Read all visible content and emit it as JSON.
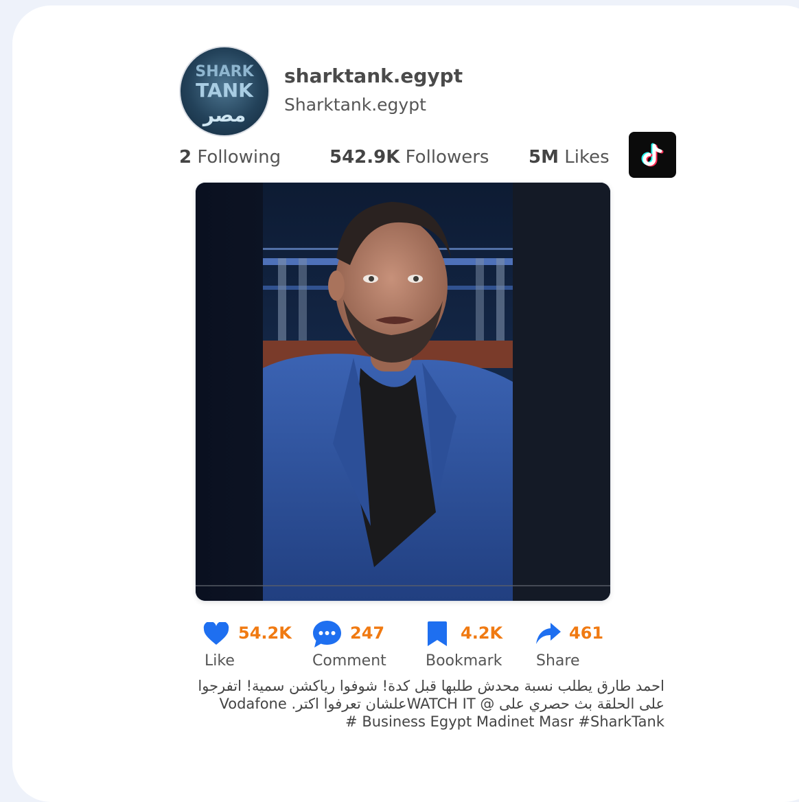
{
  "profile": {
    "username": "sharktank.egypt",
    "handle": "Sharktank.egypt",
    "avatar_text": {
      "line1": "SHARK",
      "line2": "TANK",
      "line3": "مصر"
    }
  },
  "stats": {
    "following": {
      "value": "2",
      "label": "Following"
    },
    "followers": {
      "value": "542.9K",
      "label": "Followers"
    },
    "likes": {
      "value": "5M",
      "label": "Likes"
    }
  },
  "platform_icon": "tiktok-icon",
  "actions": {
    "like": {
      "count": "54.2K",
      "label": "Like",
      "icon": "heart-icon"
    },
    "comment": {
      "count": "247",
      "label": "Comment",
      "icon": "chat-bubble-icon"
    },
    "bookmark": {
      "count": "4.2K",
      "label": "Bookmark",
      "icon": "bookmark-icon"
    },
    "share": {
      "count": "461",
      "label": "Share",
      "icon": "share-arrow-icon"
    }
  },
  "caption": "احمد طارق يطلب نسبة محدش طلبها قبل كدة! شوفوا رياكشن سمية! اتفرجوا\nعلى الحلقة بث حصري على @ WATCH ITعلشان تعرفوا اكتر.  Vodafone\nBusiness Egypt Madinet Masr #SharkTank #",
  "colors": {
    "accent_blue": "#1e6ff0",
    "count_orange": "#f07a12",
    "text_gray": "#555555",
    "background": "#eef2fa"
  }
}
